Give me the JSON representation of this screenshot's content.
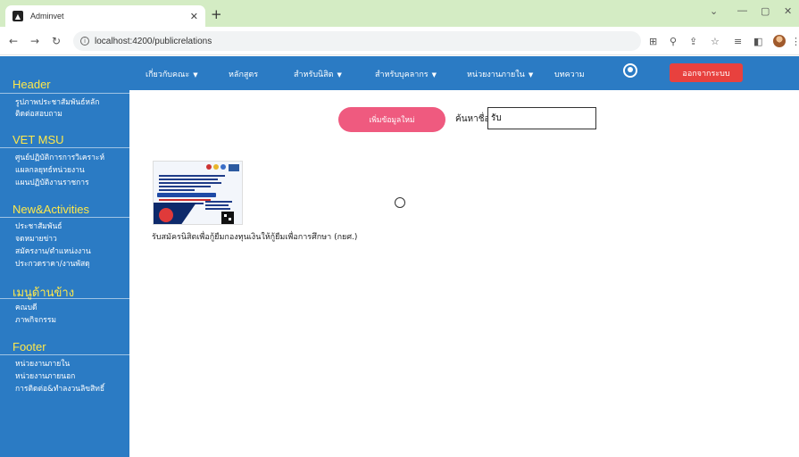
{
  "browser": {
    "tab_title": "Adminvet",
    "url": "localhost:4200/publicrelations"
  },
  "sidebar": {
    "sections": [
      {
        "title": "Header",
        "items": [
          "รูปภาพประชาสัมพันธ์หลัก",
          "ติดต่อสอบถาม"
        ]
      },
      {
        "title": "VET MSU",
        "items": [
          "ศูนย์ปฏิบัติการการวิเคราะห์",
          "แผลกลยุทธ์หน่วยงาน",
          "แผนปฏิบัติงานราชการ"
        ]
      },
      {
        "title": "New&Activities",
        "items": [
          "ประชาสัมพันธ์",
          "จดหมายข่าว",
          "สมัครงาน/ตำแหน่งงาน",
          "ประกวดราคา/งานพัสดุ"
        ]
      },
      {
        "title": "เมนูด้านข้าง",
        "items": [
          "คณบดี",
          "ภาพกิจกรรม"
        ]
      },
      {
        "title": "Footer",
        "items": [
          "หน่วยงานภายใน",
          "หน่วยงานภายนอก",
          "การติดต่อ&ทำลงวนลิขสิทธิ์"
        ]
      }
    ]
  },
  "topnav": {
    "items": [
      {
        "label": "เกี่ยวกับคณะ",
        "dropdown": true
      },
      {
        "label": "หลักสูตร",
        "dropdown": false
      },
      {
        "label": "สำหรับนิสิต",
        "dropdown": true
      },
      {
        "label": "สำหรับบุคลากร",
        "dropdown": true
      },
      {
        "label": "หน่วยงานภายใน",
        "dropdown": true
      },
      {
        "label": "บทความ",
        "dropdown": false
      }
    ],
    "logout_label": "ออกจากระบบ"
  },
  "main": {
    "add_button_label": "เพิ่มข้อมูลใหม่",
    "search_label": "ค้นหาชื่อ",
    "search_value": "รับ",
    "cards": [
      {
        "caption": "รับสมัครนิสิตเพื่อกู้ยืมกองทุนเงินให้กู้ยืมเพื่อการศึกษา (กยศ.)"
      }
    ]
  },
  "colors": {
    "primary_blue": "#2b7bc4",
    "section_yellow": "#ffe84a",
    "logout_red": "#e8413e",
    "add_pink": "#ef5a7f",
    "tabstrip_green": "#d4ecc4"
  }
}
